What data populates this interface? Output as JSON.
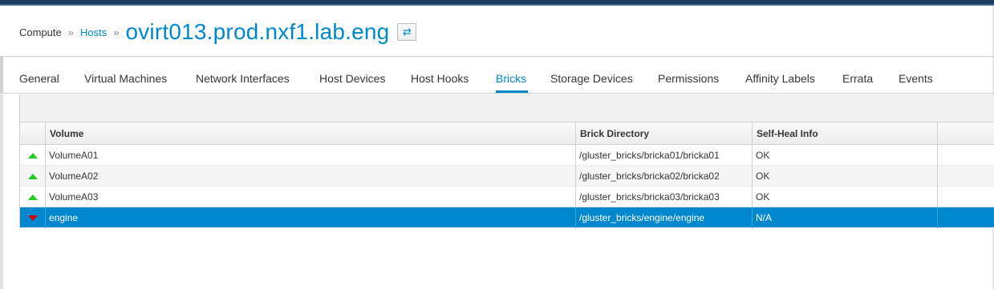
{
  "breadcrumb": {
    "compute": "Compute",
    "separator": "»",
    "hosts": "Hosts",
    "separator2": "»"
  },
  "host": {
    "name": "ovirt013.prod.nxf1.lab.eng",
    "swap_icon": "⇄"
  },
  "tabs": [
    {
      "label": "General"
    },
    {
      "label": "Virtual Machines"
    },
    {
      "label": "Network Interfaces"
    },
    {
      "label": "Host Devices"
    },
    {
      "label": "Host Hooks"
    },
    {
      "label": "Bricks",
      "active": true
    },
    {
      "label": "Storage Devices"
    },
    {
      "label": "Permissions"
    },
    {
      "label": "Affinity Labels"
    },
    {
      "label": "Errata"
    },
    {
      "label": "Events"
    }
  ],
  "grid": {
    "columns": [
      "Volume",
      "Brick Directory",
      "Self-Heal Info"
    ],
    "rows": [
      {
        "status": "up",
        "volume": "VolumeA01",
        "brick_directory": "/gluster_bricks/bricka01/bricka01",
        "self_heal": "OK"
      },
      {
        "status": "up",
        "volume": "VolumeA02",
        "brick_directory": "/gluster_bricks/bricka02/bricka02",
        "self_heal": "OK"
      },
      {
        "status": "up",
        "volume": "VolumeA03",
        "brick_directory": "/gluster_bricks/bricka03/bricka03",
        "self_heal": "OK"
      },
      {
        "status": "down",
        "volume": "engine",
        "brick_directory": "/gluster_bricks/engine/engine",
        "self_heal": "N/A",
        "selected": true
      }
    ]
  },
  "colors": {
    "accent": "#0088ce",
    "status_up": "#22cc22",
    "status_down": "#cc0000",
    "selected_row": "#0088ce"
  }
}
